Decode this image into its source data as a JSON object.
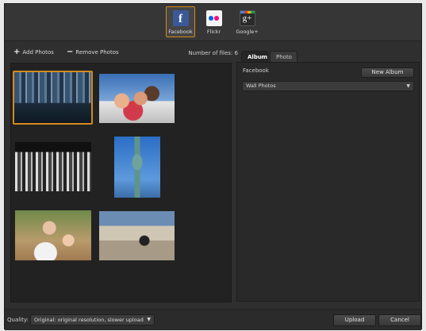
{
  "services": [
    {
      "label": "Facebook",
      "icon": "facebook-icon",
      "glyph": "f",
      "active": true
    },
    {
      "label": "Flickr",
      "icon": "flickr-icon",
      "active": false
    },
    {
      "label": "Google+",
      "icon": "google-plus-icon",
      "glyph": "g+",
      "active": false
    }
  ],
  "toolbar": {
    "add_label": "Add Photos",
    "remove_label": "Remove Photos",
    "file_count_label": "Number of files: 6"
  },
  "photos": [
    {
      "subject": "city skyline",
      "selected": true
    },
    {
      "subject": "family group",
      "selected": false
    },
    {
      "subject": "cafe tables",
      "selected": false
    },
    {
      "subject": "statue of liberty",
      "selected": false
    },
    {
      "subject": "family at restaurant",
      "selected": false
    },
    {
      "subject": "street with stroller",
      "selected": false
    }
  ],
  "tabs": [
    {
      "label": "Album",
      "active": true
    },
    {
      "label": "Photo",
      "active": false
    }
  ],
  "album_panel": {
    "account_label": "Facebook",
    "new_album_label": "New Album",
    "selected_album": "Wall Photos"
  },
  "bottom": {
    "quality_label": "Quality:",
    "quality_value": "Original: original resolution, slower upload",
    "upload_label": "Upload",
    "cancel_label": "Cancel"
  },
  "colors": {
    "accent": "#d38a1e",
    "background": "#2f2f2f",
    "facebook": "#3b5998"
  }
}
